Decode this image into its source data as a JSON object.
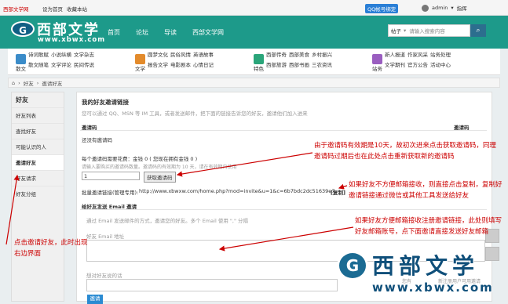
{
  "topbar": {
    "site_link": "西部文学网",
    "set_home": "设为首页",
    "bookmark": "收藏本站",
    "qq_bind": "QQ帐号绑定",
    "user": "admin",
    "points": "指挥"
  },
  "header": {
    "logo_cn": "西部文学",
    "logo_url": "www.xbwx.com",
    "nav": [
      "首页",
      "论坛",
      "导读",
      "西部文学网"
    ],
    "search_scope": "帖子",
    "search_placeholder": "请输入搜索内容"
  },
  "subnav": [
    {
      "label": "散文",
      "links": [
        "诗词歌赋",
        "散文随笔",
        "小说纵横",
        "文学评论",
        "文学杂志",
        "民间传说"
      ],
      "color": "#3b8cc9"
    },
    {
      "label": "文学",
      "links": [
        "圆梦文化",
        "报告文学",
        "民俗风情",
        "电影剧本",
        "英语故事",
        "心情日记"
      ],
      "color": "#e38b2c"
    },
    {
      "label": "特色",
      "links": [
        "西部传奇",
        "西部旅游",
        "西部美食",
        "西部书画",
        "乡村振兴",
        "三农资讯"
      ],
      "color": "#2aa57a"
    },
    {
      "label": "站务",
      "links": [
        "新人报道",
        "文学期刊",
        "作家风采",
        "官方公告",
        "站务处理",
        "活动中心"
      ],
      "color": "#9a5ec0"
    }
  ],
  "breadcrumb": [
    "好友",
    "邀请好友"
  ],
  "sidebar": {
    "title": "好友",
    "items": [
      "好友列表",
      "查找好友",
      "可能认识的人",
      "邀请好友",
      "好友请求",
      "好友分组"
    ]
  },
  "main": {
    "title": "我的好友邀请链接",
    "intro": "您可以通过 QQ、MSN 等 IM 工具，或者发送邮件，把下面的链接告诉您的好友，邀请他们加入进来",
    "code_head": "邀请码",
    "code_head_right": "邀请码",
    "no_code": "还没有邀请码",
    "cost_text": "每个邀请码需要花费：金钱 0 ( 您现在拥有金钱 0 )",
    "buy_hint": "请输入要购买的邀请码数量。邀请码的有效期为 10 天，请在有效期内使用",
    "qty_value": "1",
    "buy_btn": "获取邀请码",
    "link_label": "批量邀请链接(管理专用):",
    "link_url": "http://www.xbwxw.com/home.php?mod=invite&u=1&c=6b7bdc2dc51639e7",
    "copy": "[复制]",
    "email_title": "给好友发送 Email 邀请",
    "email_desc": "通过 Email 发送邮件的方式，邀请您的好友。多个 Email 使用 \",\" 分隔",
    "email_placeholder": "好友 Email 地址",
    "msg_placeholder": "想对好友说的话",
    "submit": "邀请",
    "frag1": "您有",
    "frag2": "新注册用户可用邀请"
  },
  "annotations": {
    "a1": "由于邀请码有效期是10天，故初次进来点击获取邀请码，同理邀请码过期后也在此处点击重新获取新的邀请码",
    "a2": "如果好友不方便邮箱接收，则直接点击复制，复制好邀请链接通过微信或其他工具发送给好友",
    "a3": "如果好友方便邮箱接收注册邀请链接，此处则填写好友邮箱账号，点下面邀请直接发送好友邮箱",
    "a4": "点击邀请好友，此时出现右边界面"
  },
  "watermark": {
    "cn": "西部文学",
    "url": "www.xbwx.com"
  }
}
